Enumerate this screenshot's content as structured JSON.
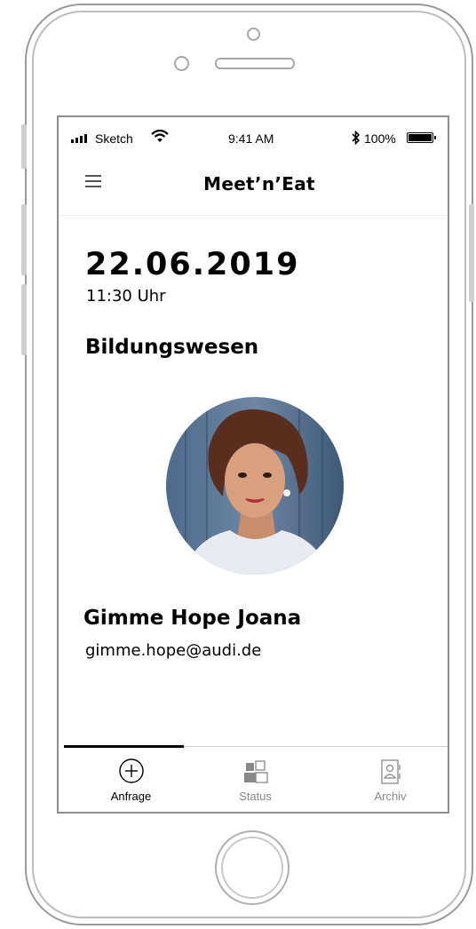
{
  "status_bar": {
    "carrier": "Sketch",
    "time": "9:41 AM",
    "battery_percent": "100%",
    "battery_level": 1.0
  },
  "nav": {
    "title": "Meet’n’Eat",
    "menu_icon": "hamburger-menu-icon"
  },
  "event": {
    "date": "22.06.2019",
    "time": "11:30 Uhr",
    "category": "Bildungswesen"
  },
  "contact": {
    "name": "Gimme Hope Joana",
    "email": "gimme.hope@audi.de",
    "avatar": "profile-photo"
  },
  "tabs": [
    {
      "label": "Anfrage",
      "icon": "plus-circle-icon",
      "active": true,
      "color": "#000000"
    },
    {
      "label": "Status",
      "icon": "status-icon",
      "active": false,
      "color": "#888888"
    },
    {
      "label": "Archiv",
      "icon": "archive-icon",
      "active": false,
      "color": "#888888"
    }
  ],
  "colors": {
    "text": "#000000",
    "inactive": "#888888",
    "frame": "#9a9a9a"
  }
}
